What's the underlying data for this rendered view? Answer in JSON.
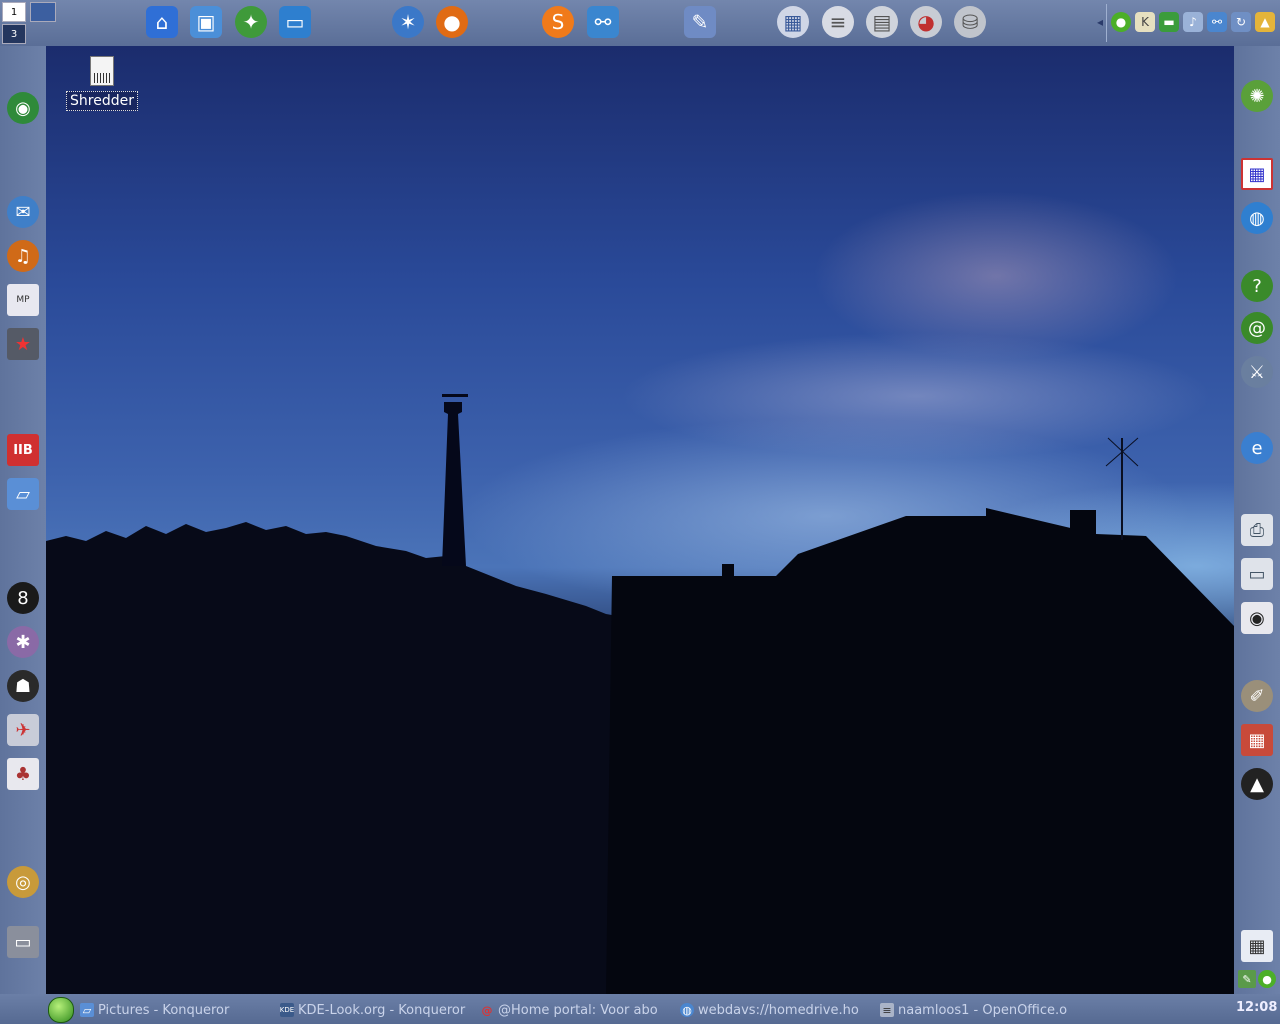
{
  "desktop": {
    "icons": [
      {
        "label": "Shredder",
        "icon": "shredder-icon"
      }
    ]
  },
  "top_panel": {
    "pager": [
      "1",
      "3"
    ],
    "launchers": [
      {
        "icon": "home-icon",
        "color": "#2f6fd6"
      },
      {
        "icon": "image-viewer-icon",
        "color": "#4b8fd8"
      },
      {
        "icon": "control-center-icon",
        "color": "#3f9a3a"
      },
      {
        "icon": "monitor-icon",
        "color": "#2e7fcf"
      },
      {
        "icon": "network-star-icon",
        "color": "#3b78c8"
      },
      {
        "icon": "firefox-icon",
        "color": "#e06b14"
      },
      {
        "icon": "skype-icon",
        "color": "#f07a1a"
      },
      {
        "icon": "network-share-icon",
        "color": "#3a86cf"
      },
      {
        "icon": "brush-icon",
        "color": "#6f8bc4"
      },
      {
        "icon": "calendar-icon",
        "color": "#d0d6e6"
      },
      {
        "icon": "notes-icon",
        "color": "#d8dbe4"
      },
      {
        "icon": "presentation-icon",
        "color": "#d0d4dc"
      },
      {
        "icon": "chart-icon",
        "color": "#c8ccd4"
      },
      {
        "icon": "database-icon",
        "color": "#c0c4cc"
      }
    ],
    "tray": [
      {
        "icon": "suse-icon",
        "color": "#4caf28"
      },
      {
        "icon": "k-icon",
        "color": "#e6e0c0"
      },
      {
        "icon": "network-card-icon",
        "color": "#3b9c3b"
      },
      {
        "icon": "volume-icon",
        "color": "#9ab2d8"
      },
      {
        "icon": "network-icon",
        "color": "#4a86cf"
      },
      {
        "icon": "update-icon",
        "color": "#6f8fc4"
      },
      {
        "icon": "kfm-icon",
        "color": "#e4b43a"
      }
    ]
  },
  "left_panel": [
    {
      "icon": "wireless-icon",
      "color": "#2f8a3a"
    },
    {
      "icon": "thunderbird-icon",
      "color": "#3f7fc8"
    },
    {
      "icon": "amarok-icon",
      "color": "#d06a18"
    },
    {
      "icon": "mplayer-icon",
      "color": "#e8e8f0"
    },
    {
      "icon": "film-icon",
      "color": "#555a66"
    },
    {
      "icon": "kib-icon",
      "color": "#d03030"
    },
    {
      "icon": "folder-network-icon",
      "color": "#5a8fd6"
    },
    {
      "icon": "pool-ball-icon",
      "color": "#1a1a1a"
    },
    {
      "icon": "bug-icon",
      "color": "#8a6aa6"
    },
    {
      "icon": "penguin-icon",
      "color": "#2a2a2a"
    },
    {
      "icon": "mail-box-icon",
      "color": "#c8ccd8"
    },
    {
      "icon": "cards-icon",
      "color": "#e8e8ee"
    },
    {
      "icon": "webcam-icon",
      "color": "#c89a3a"
    },
    {
      "icon": "laptop-icon",
      "color": "#8a8f9c"
    }
  ],
  "right_panel": [
    {
      "icon": "kopete-icon",
      "color": "#5aa03a"
    },
    {
      "icon": "color-chart-icon",
      "color": "#ffffff"
    },
    {
      "icon": "globe-icon",
      "color": "#2f7fd0"
    },
    {
      "icon": "help-icon",
      "color": "#3a8a2a"
    },
    {
      "icon": "at-icon",
      "color": "#3a8a2a"
    },
    {
      "icon": "satellite-icon",
      "color": "#6a7f9f"
    },
    {
      "icon": "search-web-icon",
      "color": "#3a7fd0"
    },
    {
      "icon": "printer-icon",
      "color": "#dfe3ea"
    },
    {
      "icon": "scanner-icon",
      "color": "#dfe3ea"
    },
    {
      "icon": "camera-icon",
      "color": "#e8e8ee"
    },
    {
      "icon": "gimp-icon",
      "color": "#9a8f7a"
    },
    {
      "icon": "palette-icon",
      "color": "#c84a3a"
    },
    {
      "icon": "inkscape-icon",
      "color": "#222222"
    },
    {
      "icon": "calculator-icon",
      "color": "#e8ecf4"
    }
  ],
  "taskbar": {
    "tasks": [
      {
        "label": "Pictures - Konqueror",
        "icon": "folder-icon"
      },
      {
        "label": "KDE-Look.org - Konqueror",
        "icon": "kde-look-icon"
      },
      {
        "label": "@Home portal: Voor abo",
        "icon": "at-home-icon"
      },
      {
        "label": "webdavs://homedrive.ho",
        "icon": "webdav-icon"
      },
      {
        "label": "naamloos1 - OpenOffice.o",
        "icon": "openoffice-icon"
      }
    ],
    "clock": "12:08"
  }
}
